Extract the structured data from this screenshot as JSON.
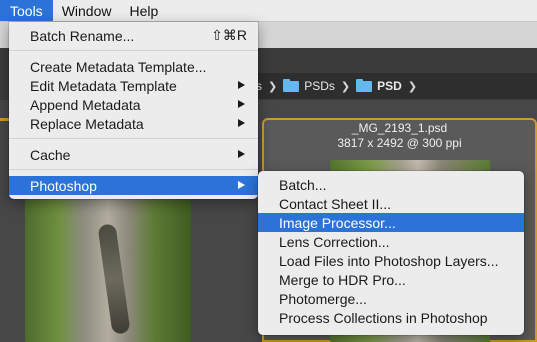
{
  "menubar": {
    "items": [
      {
        "label": "Tools"
      },
      {
        "label": "Window"
      },
      {
        "label": "Help"
      }
    ]
  },
  "tools_menu": {
    "items": [
      {
        "label": "Batch Rename...",
        "shortcut": "⇧⌘R"
      },
      {
        "label": "Create Metadata Template..."
      },
      {
        "label": "Edit Metadata Template"
      },
      {
        "label": "Append Metadata"
      },
      {
        "label": "Replace Metadata"
      },
      {
        "label": "Cache"
      },
      {
        "label": "Photoshop"
      }
    ]
  },
  "photoshop_submenu": {
    "items": [
      {
        "label": "Batch..."
      },
      {
        "label": "Contact Sheet II..."
      },
      {
        "label": "Image Processor..."
      },
      {
        "label": "Lens Correction..."
      },
      {
        "label": "Load Files into Photoshop Layers..."
      },
      {
        "label": "Merge to HDR Pro..."
      },
      {
        "label": "Photomerge..."
      },
      {
        "label": "Process Collections in Photoshop"
      }
    ]
  },
  "breadcrumb": {
    "partial": "s",
    "folders": [
      "PSDs",
      "PSD"
    ]
  },
  "thumbnail": {
    "filename": "_MG_2193_1.psd",
    "info": "3817 x 2492 @ 300 ppi"
  },
  "colors": {
    "accent": "#2b73d8",
    "selection_border": "#d29a2b",
    "folder": "#63b8ee"
  }
}
